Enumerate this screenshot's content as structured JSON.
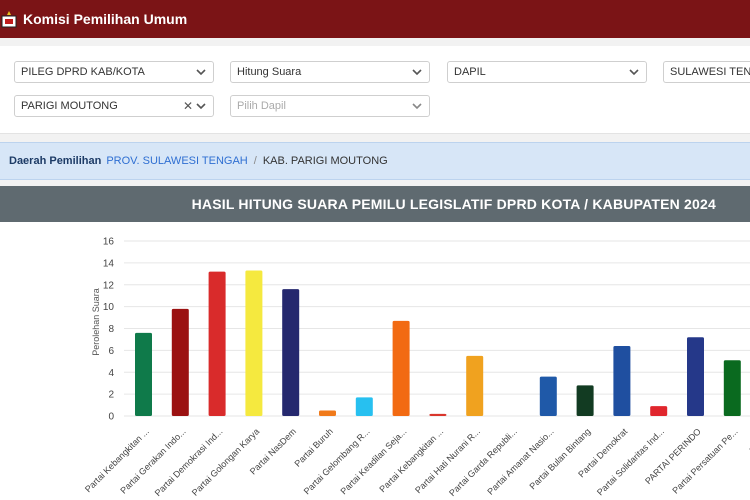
{
  "app": {
    "title": "Komisi Pemilihan Umum"
  },
  "filters": {
    "jenis": "PILEG DPRD KAB/KOTA",
    "tipe": "Hitung Suara",
    "wilayah": "DAPIL",
    "provinsi": "SULAWESI TENGAH",
    "kabupaten": "PARIGI MOUTONG",
    "dapil_placeholder": "Pilih Dapil"
  },
  "breadcrumb": {
    "label": "Daerah Pemilihan",
    "province": "PROV. SULAWESI TENGAH",
    "separator": "/",
    "current": "KAB. PARIGI MOUTONG"
  },
  "chart_data": {
    "type": "bar",
    "title": "HASIL HITUNG SUARA PEMILU LEGISLATIF DPRD KOTA / KABUPATEN 2024",
    "ylabel": "Perolehan Suara",
    "ylim": [
      0,
      16
    ],
    "yticks": [
      0,
      2,
      4,
      6,
      8,
      10,
      12,
      14,
      16
    ],
    "categories": [
      "Partai Kebangkitan ...",
      "Partai Gerakan Indo...",
      "Partai Demokrasi Ind...",
      "Partai Golongan Karya",
      "Partai NasDem",
      "Partai Buruh",
      "Partai Gelombang R...",
      "Partai Keadilan Seja...",
      "Partai Kebangkitan ...",
      "Partai Hati Nurani R...",
      "Partai Garda Republi...",
      "Partai Amanat Nasio...",
      "Partai Bulan Bintang",
      "Partai Demokrat",
      "Partai Solidaritas Ind...",
      "PARTAI PERINDO",
      "Partai Persatuan Pe...",
      "Partai..."
    ],
    "values": [
      7.6,
      9.8,
      13.2,
      13.3,
      11.6,
      0.5,
      1.7,
      8.7,
      0.2,
      5.5,
      0,
      3.6,
      2.8,
      6.4,
      0.9,
      7.2,
      5.1,
      0
    ],
    "colors": [
      "#0f7a4a",
      "#9b1111",
      "#d92b2b",
      "#f5e93f",
      "#25286e",
      "#f07a1a",
      "#27c0f0",
      "#f26a12",
      "#d9362c",
      "#f0a21f",
      "#b01c1c",
      "#1f59a8",
      "#123b22",
      "#1f4fa0",
      "#e0262d",
      "#253889",
      "#0a6a1f",
      "#2a2a70"
    ],
    "grid": true
  }
}
